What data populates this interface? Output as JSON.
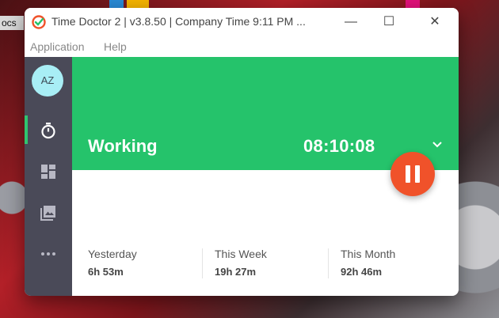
{
  "desktop": {
    "side_label": "ocs"
  },
  "window": {
    "title": "Time Doctor 2 | v3.8.50 | Company Time 9:11 PM ...",
    "minimize_symbol": "—",
    "maximize_symbol": "☐",
    "close_symbol": "✕"
  },
  "menu": {
    "items": [
      {
        "label": "Application"
      },
      {
        "label": "Help"
      }
    ]
  },
  "sidebar": {
    "avatar_initials": "AZ",
    "items": [
      {
        "icon": "timer-icon",
        "active": true
      },
      {
        "icon": "dashboard-icon",
        "active": false
      },
      {
        "icon": "gallery-icon",
        "active": false
      },
      {
        "icon": "more-icon",
        "active": false
      }
    ]
  },
  "tracker": {
    "status": "Working",
    "elapsed": "08:10:08"
  },
  "stats": [
    {
      "label": "Yesterday",
      "value": "6h 53m"
    },
    {
      "label": "This Week",
      "value": "19h 27m"
    },
    {
      "label": "This Month",
      "value": "92h 46m"
    }
  ],
  "colors": {
    "accent_green": "#25c36b",
    "pause_red": "#f0522a",
    "sidebar": "#4a4a58",
    "avatar_bg": "#a8eef5"
  }
}
